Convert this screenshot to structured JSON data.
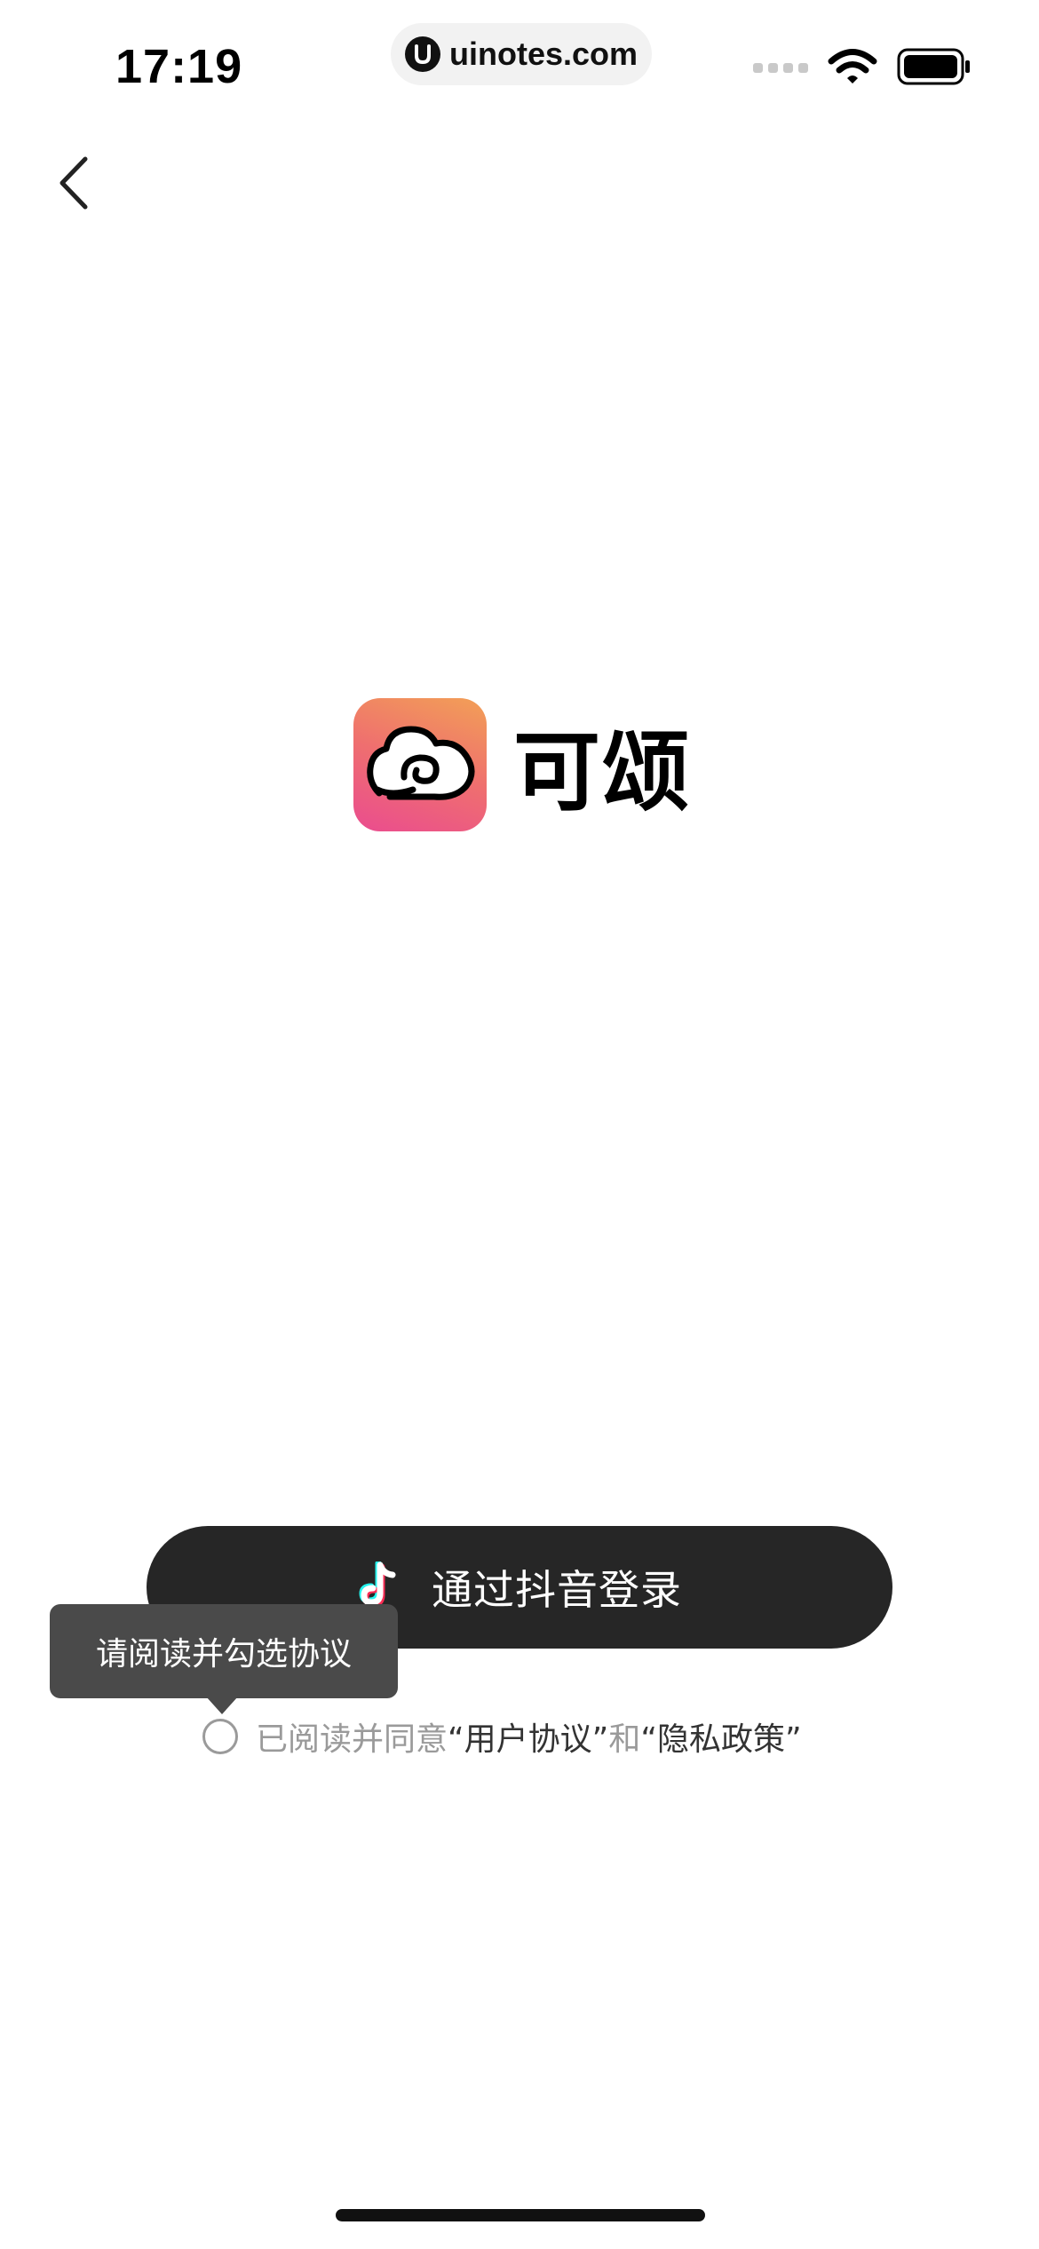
{
  "status_bar": {
    "time": "17:19",
    "url": "uinotes.com",
    "icons": [
      "signal-icon",
      "wifi-icon",
      "battery-icon"
    ]
  },
  "nav": {
    "back_icon": "chevron-left-icon"
  },
  "brand": {
    "app_name": "可颂",
    "icon": "croissant-cloud-logo",
    "gradient_colors": [
      "#f2a056",
      "#ef6f6f",
      "#ea4c8f"
    ]
  },
  "login": {
    "label": "通过抖音登录",
    "icon": "douyin-icon",
    "background": "#262626"
  },
  "tooltip": {
    "text": "请阅读并勾选协议"
  },
  "agreement": {
    "prefix": "已阅读并同意",
    "user_agreement": "“用户协议”",
    "conjunction": "和",
    "privacy_policy": "“隐私政策”",
    "checked": false
  }
}
